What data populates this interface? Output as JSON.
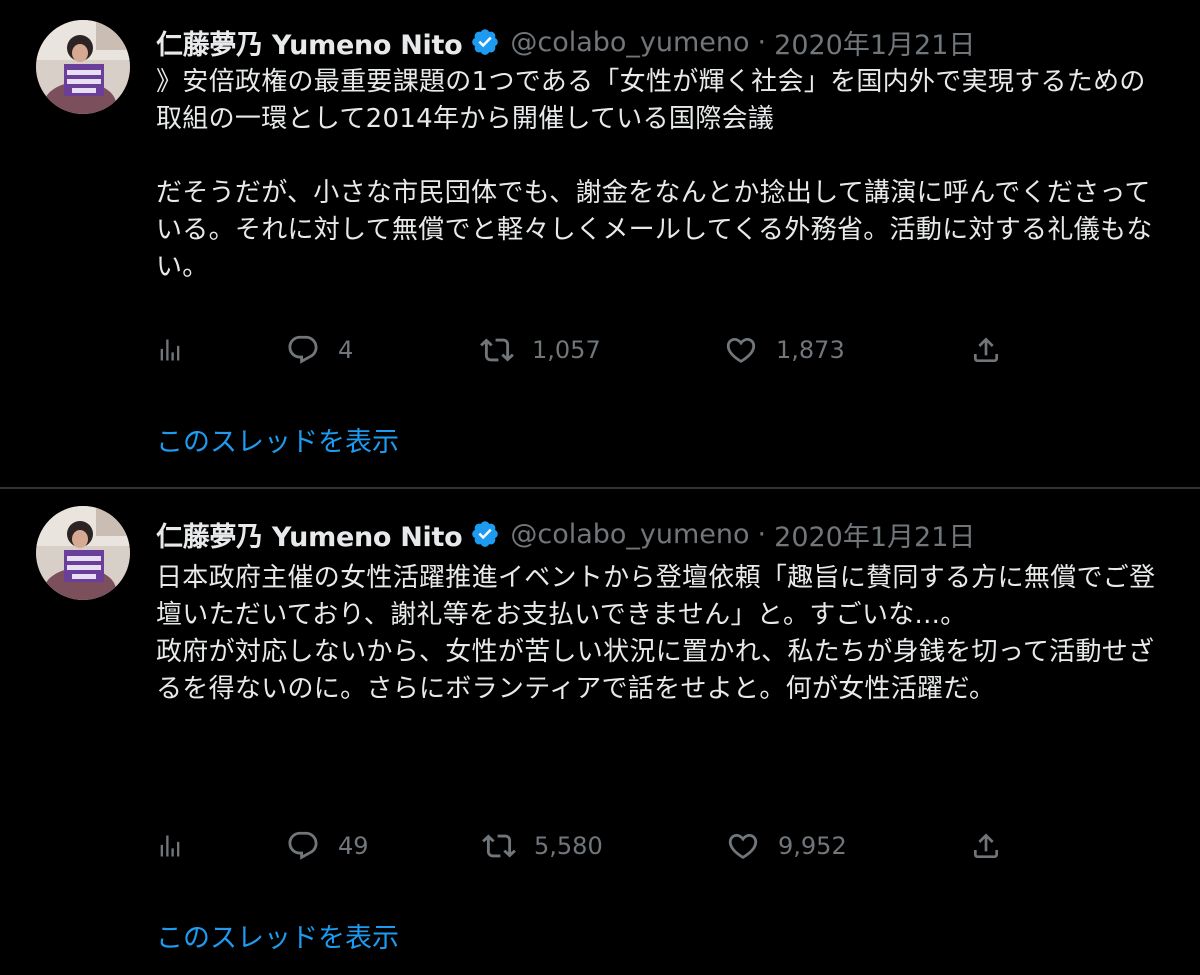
{
  "colors": {
    "background": "#000000",
    "text": "#e7e9ea",
    "secondary": "#71767b",
    "link": "#1d9bf0",
    "divider": "#2f3336"
  },
  "tweets": [
    {
      "display_name": "仁藤夢乃 Yumeno Nito",
      "handle": "@colabo_yumeno",
      "separator": "·",
      "date": "2020年1月21日",
      "verified_icon": "verified-badge-icon",
      "text": "》安倍政権の最重要課題の1つである「女性が輝く社会」を国内外で実現するための取組の一環として2014年から開催している国際会議\n\nだそうだが、小さな市民団体でも、謝金をなんとか捻出して講演に呼んでくださっている。それに対して無償でと軽々しくメールしてくる外務省。活動に対する礼儀もない。",
      "actions": {
        "reply_count": "4",
        "retweet_count": "1,057",
        "like_count": "1,873"
      },
      "thread_link": "このスレッドを表示"
    },
    {
      "display_name": "仁藤夢乃 Yumeno Nito",
      "handle": "@colabo_yumeno",
      "separator": "·",
      "date": "2020年1月21日",
      "verified_icon": "verified-badge-icon",
      "text": "日本政府主催の女性活躍推進イベントから登壇依頼「趣旨に賛同する方に無償でご登壇いただいており、謝礼等をお支払いできません」と。すごいな...。\n政府が対応しないから、女性が苦しい状況に置かれ、私たちが身銭を切って活動せざるを得ないのに。さらにボランティアで話をせよと。何が女性活躍だ。",
      "actions": {
        "reply_count": "49",
        "retweet_count": "5,580",
        "like_count": "9,952"
      },
      "thread_link": "このスレッドを表示"
    }
  ]
}
